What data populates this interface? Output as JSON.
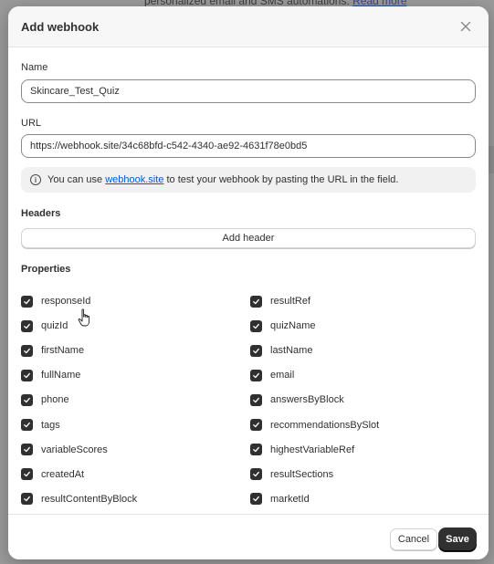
{
  "background": {
    "text": "personalized email and SMS automations.",
    "link": "Read more"
  },
  "modal": {
    "title": "Add webhook",
    "close_icon": "close-icon"
  },
  "form": {
    "name_label": "Name",
    "name_value": "Skincare_Test_Quiz",
    "url_label": "URL",
    "url_value": "https://webhook.site/34c68bfd-c542-4340-ae92-4631f78e0bd5",
    "info_prefix": "You can use ",
    "info_link": "webhook.site",
    "info_suffix": " to test your webhook by pasting the URL in the field."
  },
  "headers": {
    "heading": "Headers",
    "add_button": "Add header"
  },
  "properties": {
    "heading": "Properties",
    "items": [
      {
        "label": "responseId",
        "checked": true
      },
      {
        "label": "resultRef",
        "checked": true
      },
      {
        "label": "quizId",
        "checked": true
      },
      {
        "label": "quizName",
        "checked": true
      },
      {
        "label": "firstName",
        "checked": true
      },
      {
        "label": "lastName",
        "checked": true
      },
      {
        "label": "fullName",
        "checked": true
      },
      {
        "label": "email",
        "checked": true
      },
      {
        "label": "phone",
        "checked": true
      },
      {
        "label": "answersByBlock",
        "checked": true
      },
      {
        "label": "tags",
        "checked": true
      },
      {
        "label": "recommendationsBySlot",
        "checked": true
      },
      {
        "label": "variableScores",
        "checked": true
      },
      {
        "label": "highestVariableRef",
        "checked": true
      },
      {
        "label": "createdAt",
        "checked": true
      },
      {
        "label": "resultSections",
        "checked": true
      },
      {
        "label": "resultContentByBlock",
        "checked": true
      },
      {
        "label": "marketId",
        "checked": true
      }
    ]
  },
  "footer": {
    "cancel": "Cancel",
    "save": "Save"
  },
  "colors": {
    "primary_button": "#303030",
    "link": "#005bd3",
    "checkbox": "#303030"
  }
}
